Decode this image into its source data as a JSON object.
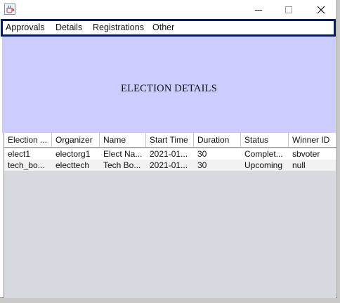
{
  "window": {
    "app_icon": "java-coffee-icon",
    "controls": {
      "minimize": "—",
      "maximize": "☐",
      "close": "✕"
    }
  },
  "menubar": {
    "items": [
      {
        "label": "Approvals"
      },
      {
        "label": "Details"
      },
      {
        "label": "Registrations"
      },
      {
        "label": "Other"
      }
    ]
  },
  "panel": {
    "title": "ELECTION DETAILS",
    "background": "#ccccff"
  },
  "table": {
    "columns": [
      "Election ...",
      "Organizer",
      "Name",
      "Start Time",
      "Duration",
      "Status",
      "Winner ID"
    ],
    "rows": [
      [
        "elect1",
        "electorg1",
        "Elect Na...",
        "2021-01...",
        "30",
        "Complet...",
        "sbvoter"
      ],
      [
        "tech_bo...",
        "electtech",
        "Tech Bo...",
        "2021-01...",
        "30",
        "Upcoming",
        "null"
      ]
    ]
  }
}
